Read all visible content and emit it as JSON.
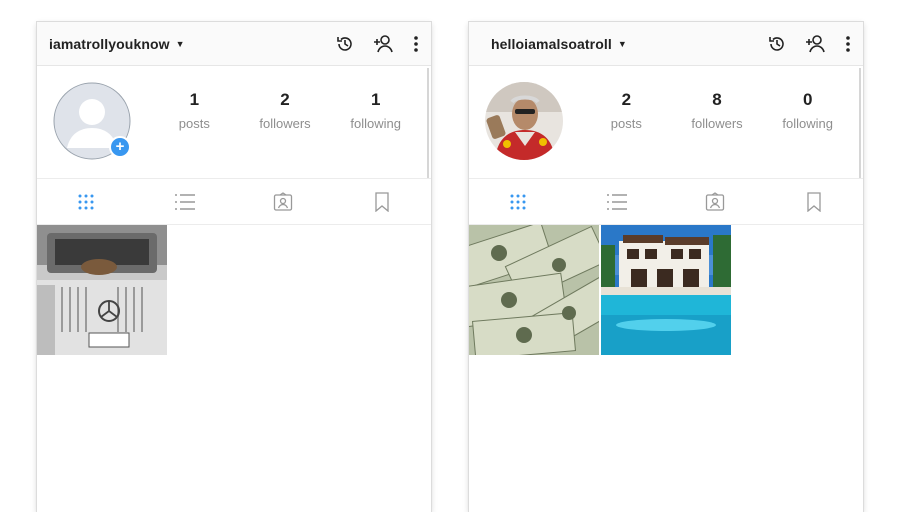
{
  "profiles": [
    {
      "username": "iamatrollyouknow",
      "stats": [
        {
          "value": "1",
          "label": "posts"
        },
        {
          "value": "2",
          "label": "followers"
        },
        {
          "value": "1",
          "label": "following"
        }
      ],
      "posts": [
        "car-photo"
      ]
    },
    {
      "username": "helloiamalsoatroll",
      "stats": [
        {
          "value": "2",
          "label": "posts"
        },
        {
          "value": "8",
          "label": "followers"
        },
        {
          "value": "0",
          "label": "following"
        }
      ],
      "posts": [
        "money-photo",
        "mansion-photo"
      ]
    }
  ],
  "icons": {
    "history": "history-icon",
    "add_person": "add-person-icon",
    "more": "more-vertical-icon",
    "grid": "grid-icon",
    "list": "list-icon",
    "tagged": "tagged-icon",
    "saved": "bookmark-icon"
  },
  "colors": {
    "accent": "#3897f0",
    "muted": "#8e8e8e",
    "text": "#222222"
  }
}
